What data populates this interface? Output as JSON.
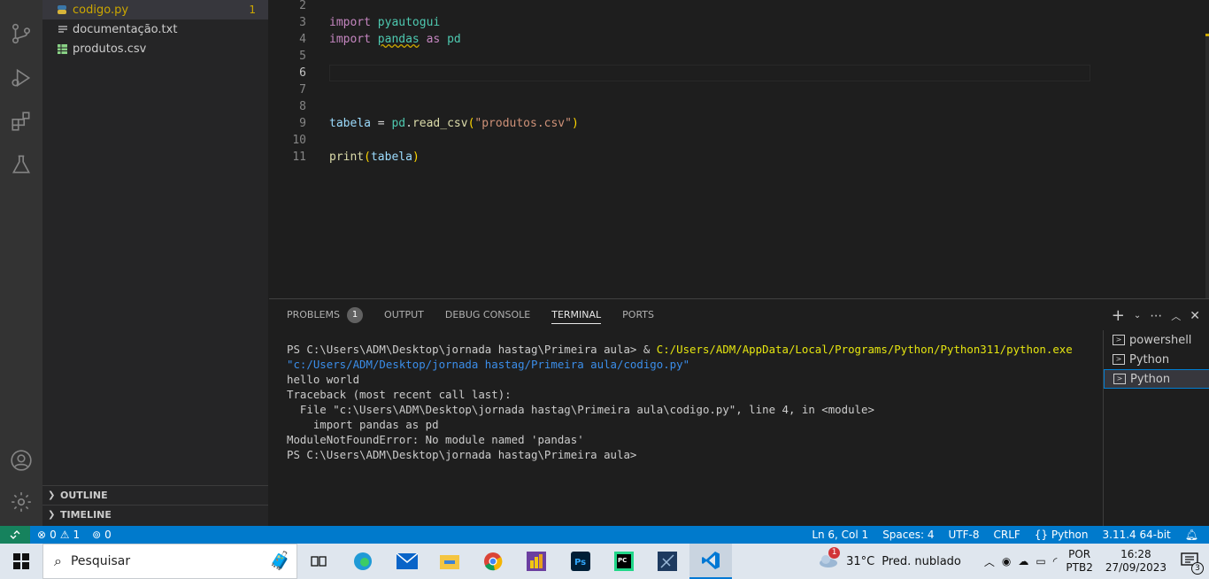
{
  "explorer": {
    "files": [
      {
        "name": "codigo.py",
        "icon": "python-file-icon",
        "badge": "1"
      },
      {
        "name": "documentação.txt",
        "icon": "text-file-icon"
      },
      {
        "name": "produtos.csv",
        "icon": "csv-file-icon"
      }
    ],
    "outline_label": "OUTLINE",
    "timeline_label": "TIMELINE"
  },
  "editor": {
    "lines": [
      {
        "n": "2"
      },
      {
        "n": "3"
      },
      {
        "n": "4"
      },
      {
        "n": "5"
      },
      {
        "n": "6"
      },
      {
        "n": "7"
      },
      {
        "n": "8"
      },
      {
        "n": "9"
      },
      {
        "n": "10"
      },
      {
        "n": "11"
      }
    ],
    "code": {
      "l3_kw": "import",
      "l3_mod": "pyautogui",
      "l4_kw": "import",
      "l4_mod": "pandas",
      "l4_as": "as",
      "l4_alias": "pd",
      "l9_var": "tabela",
      "l9_eq": " = ",
      "l9_obj": "pd",
      "l9_dot": ".",
      "l9_fn": "read_csv",
      "l9_open": "(",
      "l9_str": "\"produtos.csv\"",
      "l9_close": ")",
      "l11_fn": "print",
      "l11_open": "(",
      "l11_arg": "tabela",
      "l11_close": ")"
    }
  },
  "panel": {
    "tabs": [
      {
        "label": "PROBLEMS",
        "count": "1"
      },
      {
        "label": "OUTPUT"
      },
      {
        "label": "DEBUG CONSOLE"
      },
      {
        "label": "TERMINAL"
      },
      {
        "label": "PORTS"
      }
    ],
    "terminal": {
      "prompt1": "PS C:\\Users\\ADM\\Desktop\\jornada hastag\\Primeira aula> & ",
      "exe": "C:/Users/ADM/AppData/Local/Programs/Python/Python311/python.exe",
      "arg": " \"c:/Users/ADM/Desktop/jornada hastag/Primeira aula/codigo.py\"",
      "out1": "hello world",
      "out2": "Traceback (most recent call last):",
      "out3": "  File \"c:\\Users\\ADM\\Desktop\\jornada hastag\\Primeira aula\\codigo.py\", line 4, in <module>",
      "out4": "    import pandas as pd",
      "out5": "ModuleNotFoundError: No module named 'pandas'",
      "prompt2": "PS C:\\Users\\ADM\\Desktop\\jornada hastag\\Primeira aula>"
    },
    "terminal_list": [
      "powershell",
      "Python",
      "Python"
    ]
  },
  "statusbar": {
    "errors": "0",
    "warnings": "1",
    "ports": "0",
    "position": "Ln 6, Col 1",
    "spaces": "Spaces: 4",
    "encoding": "UTF-8",
    "eol": "CRLF",
    "language": "Python",
    "interpreter": "3.11.4 64-bit"
  },
  "taskbar": {
    "search_placeholder": "Pesquisar",
    "weather_temp": "31°C",
    "weather_desc": "Pred. nublado",
    "weather_badge": "1",
    "lang": "POR",
    "layout": "PTB2",
    "time": "16:28",
    "date": "27/09/2023",
    "notifications": "3"
  },
  "colors": {
    "accent": "#007acc",
    "warning": "#cca700",
    "taskbar_bg": "#dfe6ee"
  }
}
